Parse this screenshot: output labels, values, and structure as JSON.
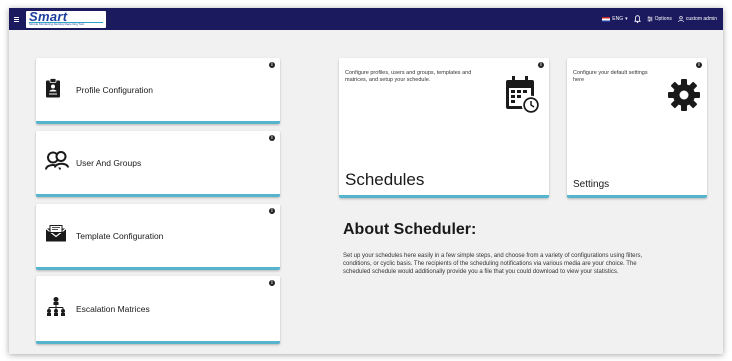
{
  "header": {
    "logo_text": "Smart",
    "logo_tagline": "Simple Monitoring Alerting Reporting Tool",
    "language": "ENG",
    "options_label": "Options",
    "user_label": "custom admin"
  },
  "left_cards": [
    {
      "label": "Profile Configuration",
      "icon": "clipboard-icon"
    },
    {
      "label": "User And Groups",
      "icon": "users-icon"
    },
    {
      "label": "Template Configuration",
      "icon": "envelope-icon"
    },
    {
      "label": "Escalation Matrices",
      "icon": "hierarchy-icon"
    }
  ],
  "schedules_card": {
    "description": "Configure profiles, users and groups, templates and matrices, and setup your schedule.",
    "title": "Schedules"
  },
  "settings_card": {
    "description": "Configure your default settings here",
    "title": "Settings"
  },
  "about": {
    "title": "About Scheduler:",
    "text": "Set up your schedules here easily in a few simple steps, and choose from a variety of configurations using filters, conditions, or cyclic basis. The recipients of the scheduling notifications via various media are your choice. The scheduled schedule would additionally provide you a file that you could download to view your statistics."
  },
  "colors": {
    "topbar": "#1c1a5e",
    "accent": "#56b4cf",
    "background": "#f1f1f1"
  }
}
